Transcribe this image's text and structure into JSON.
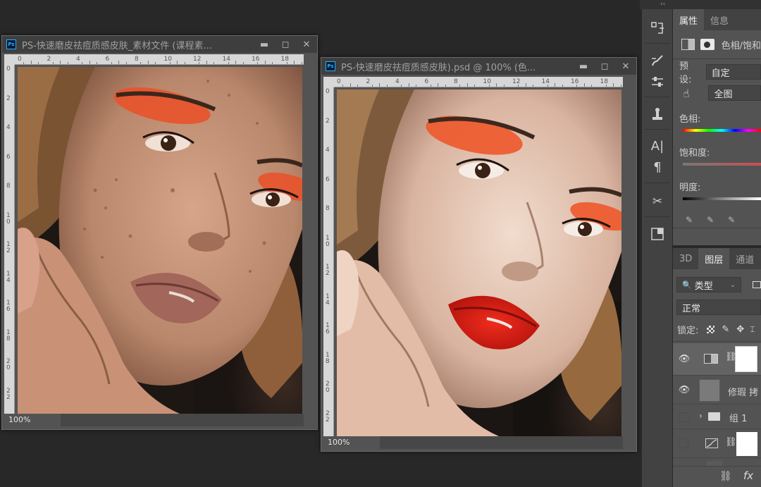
{
  "panel_collapse": "‹‹",
  "doc1": {
    "badge": "Ps",
    "title": "PS-快速磨皮祛痘质感皮肤_素材文件 (课程素...",
    "zoom": "100%",
    "ruler_h": [
      "0",
      "2",
      "4",
      "6",
      "8",
      "10",
      "12",
      "14",
      "16",
      "18"
    ],
    "ruler_v": [
      "0",
      "2",
      "4",
      "6",
      "8",
      "1\n0",
      "1\n2",
      "1\n4",
      "1\n6",
      "1\n8",
      "2\n0",
      "2\n2"
    ]
  },
  "doc2": {
    "badge": "Ps",
    "title": "PS-快速磨皮祛痘质感皮肤).psd @ 100% (色...",
    "zoom": "100%",
    "ruler_h": [
      "0",
      "2",
      "4",
      "6",
      "8",
      "10",
      "12",
      "14",
      "16",
      "18"
    ],
    "ruler_v": [
      "0",
      "2",
      "4",
      "6",
      "8",
      "1\n0",
      "1\n2",
      "1\n4",
      "1\n6",
      "1\n8",
      "2\n0",
      "2\n2"
    ]
  },
  "window_buttons": {
    "minimize": "▬",
    "restore": "◻",
    "close": "✕"
  },
  "tools": [
    "history-brush-icon",
    "brush-settings-icon",
    "adjust-sliders-icon",
    "clone-stamp-icon",
    "character-icon",
    "paragraph-icon",
    "scissors-icon",
    "mask-icon"
  ],
  "properties": {
    "tabs": [
      "属性",
      "信息"
    ],
    "adjustment_name": "色相/饱和",
    "preset_label": "预设:",
    "preset_value": "自定",
    "channel_value": "全图",
    "hue_label": "色相:",
    "saturation_label": "饱和度:",
    "lightness_label": "明度:"
  },
  "layers": {
    "tabs": [
      "3D",
      "图层",
      "通道"
    ],
    "filter_label": "类型",
    "blend_mode": "正常",
    "lock_label": "锁定:",
    "items": [
      {
        "name": "",
        "visible": true,
        "type": "hue-sat-adjustment"
      },
      {
        "name": "修瑕 拷",
        "visible": true,
        "type": "pixel"
      },
      {
        "name": "组 1",
        "visible": false,
        "type": "group"
      },
      {
        "name": "",
        "visible": false,
        "type": "curves-adjustment"
      }
    ],
    "footer_fx": "fx"
  },
  "colors": {
    "app_bg": "#282828",
    "panel_bg": "#535353",
    "accent_orange": "#e8532b",
    "lip_red": "#d81e14"
  }
}
